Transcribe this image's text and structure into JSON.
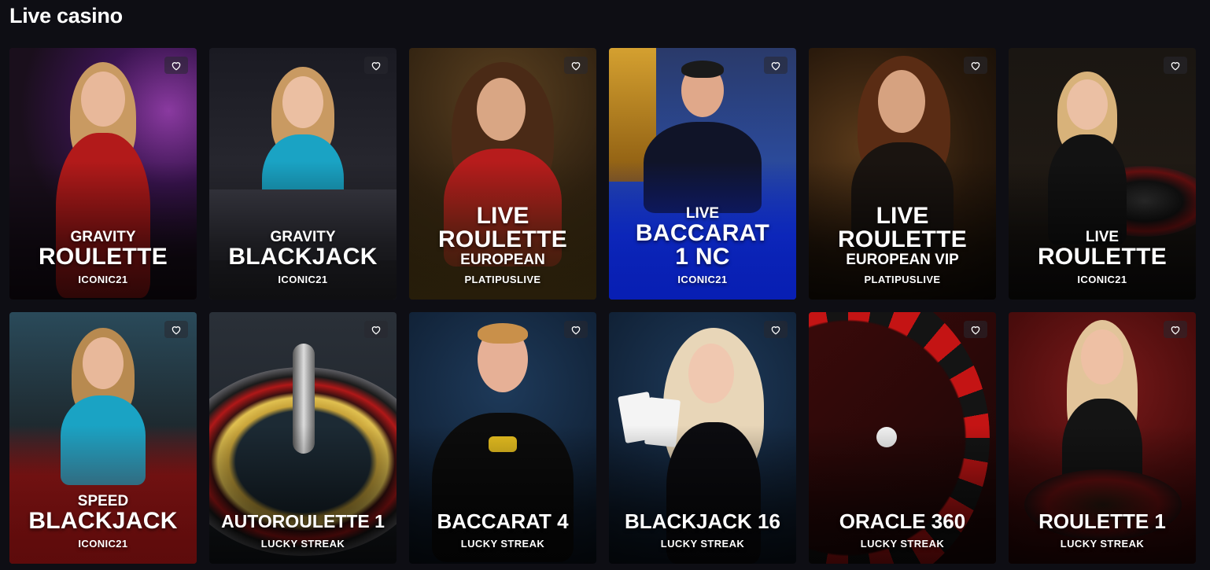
{
  "section": {
    "title": "Live casino"
  },
  "colors": {
    "page_bg": "#0e0e14",
    "text": "#ffffff"
  },
  "games": [
    {
      "line1": "GRAVITY",
      "line2": "ROULETTE",
      "line3": "",
      "provider": "ICONIC21",
      "favorite_icon": "heart-outline-icon"
    },
    {
      "line1": "GRAVITY",
      "line2": "BLACKJACK",
      "line3": "",
      "provider": "ICONIC21",
      "favorite_icon": "heart-outline-icon"
    },
    {
      "line1": "LIVE",
      "line2": "ROULETTE",
      "line3": "EUROPEAN",
      "provider": "PLATIPUSLIVE",
      "favorite_icon": "heart-outline-icon"
    },
    {
      "line1": "LIVE",
      "line2": "BACCARAT",
      "line3": "1 NC",
      "provider": "ICONIC21",
      "favorite_icon": "heart-outline-icon"
    },
    {
      "line1": "LIVE",
      "line2": "ROULETTE",
      "line3": "EUROPEAN VIP",
      "provider": "PLATIPUSLIVE",
      "favorite_icon": "heart-outline-icon"
    },
    {
      "line1": "LIVE",
      "line2": "ROULETTE",
      "line3": "",
      "provider": "ICONIC21",
      "favorite_icon": "heart-outline-icon"
    },
    {
      "line1": "SPEED",
      "line2": "BLACKJACK",
      "line3": "",
      "provider": "ICONIC21",
      "favorite_icon": "heart-outline-icon"
    },
    {
      "line1": "",
      "line2": "AUTOROULETTE 1",
      "line3": "",
      "provider": "LUCKY STREAK",
      "favorite_icon": "heart-outline-icon"
    },
    {
      "line1": "",
      "line2": "BACCARAT 4",
      "line3": "",
      "provider": "LUCKY STREAK",
      "favorite_icon": "heart-outline-icon"
    },
    {
      "line1": "",
      "line2": "BLACKJACK 16",
      "line3": "",
      "provider": "LUCKY STREAK",
      "favorite_icon": "heart-outline-icon"
    },
    {
      "line1": "",
      "line2": "ORACLE 360",
      "line3": "",
      "provider": "LUCKY STREAK",
      "favorite_icon": "heart-outline-icon"
    },
    {
      "line1": "",
      "line2": "ROULETTE 1",
      "line3": "",
      "provider": "LUCKY STREAK",
      "favorite_icon": "heart-outline-icon"
    }
  ]
}
